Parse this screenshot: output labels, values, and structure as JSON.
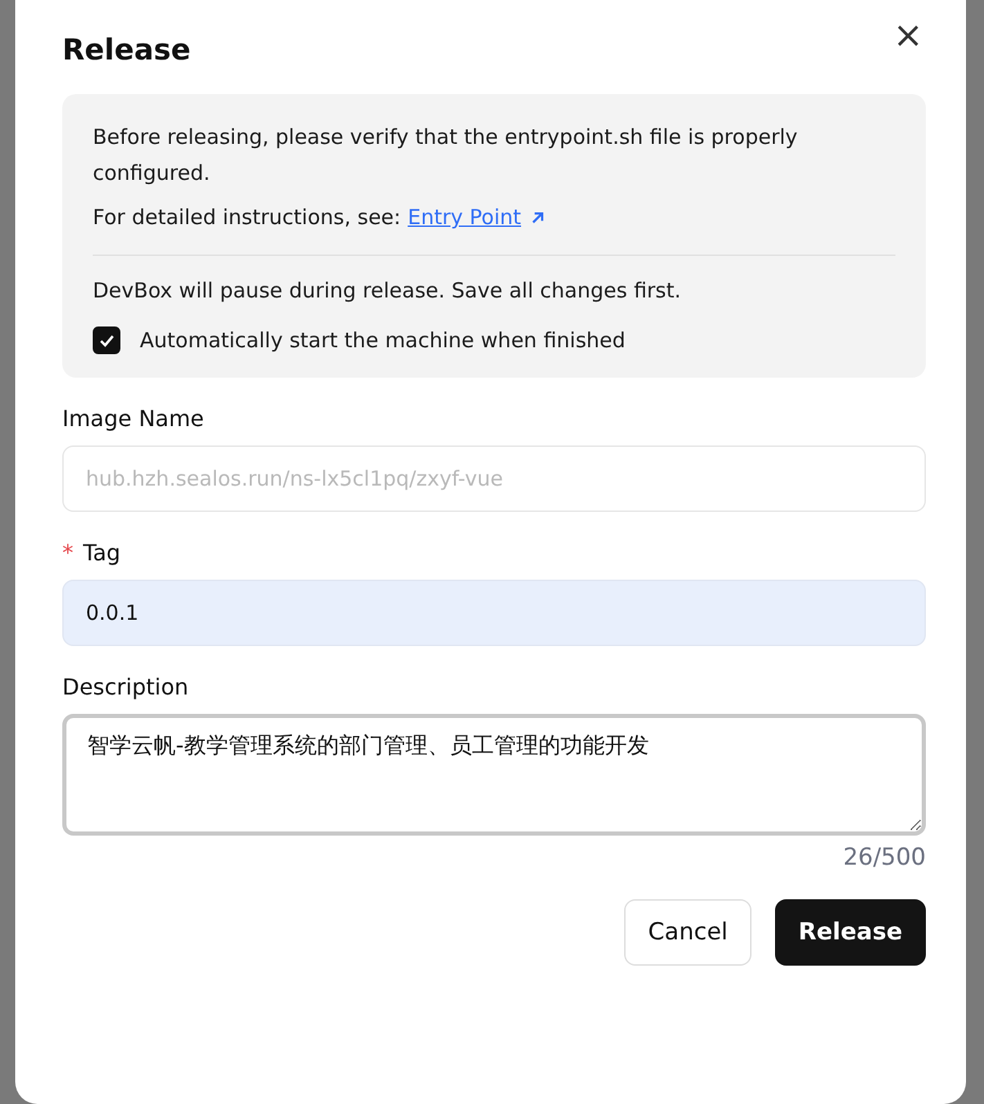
{
  "dialog": {
    "title": "Release",
    "close": "×"
  },
  "notice": {
    "line_1": "Before releasing, please verify that the entrypoint.sh file is properly configured.",
    "line_2": "For detailed instructions, see:",
    "link": "Entry Point",
    "pause_text": "DevBox will pause during release. Save all changes first.",
    "auto_start": {
      "label": "Automatically start the machine when finished",
      "checked": true
    }
  },
  "fields": [
    {
      "label": "Image Name",
      "required": false,
      "kind": "input",
      "placeholder": "hub.hzh.sealos.run/ns-lx5cl1pq/zxyf-vue"
    },
    {
      "label": "Tag",
      "required": true,
      "required_mark": "*",
      "kind": "input",
      "value": "0.0.1"
    },
    {
      "label": "Description",
      "required": false,
      "kind": "textarea",
      "value": "智学云帆-教学管理系统的部门管理、员工管理的功能开发",
      "counter": "26/500"
    }
  ],
  "buttons": [
    {
      "label": "Cancel",
      "kind": "secondary"
    },
    {
      "label": "Release",
      "kind": "primary"
    }
  ]
}
